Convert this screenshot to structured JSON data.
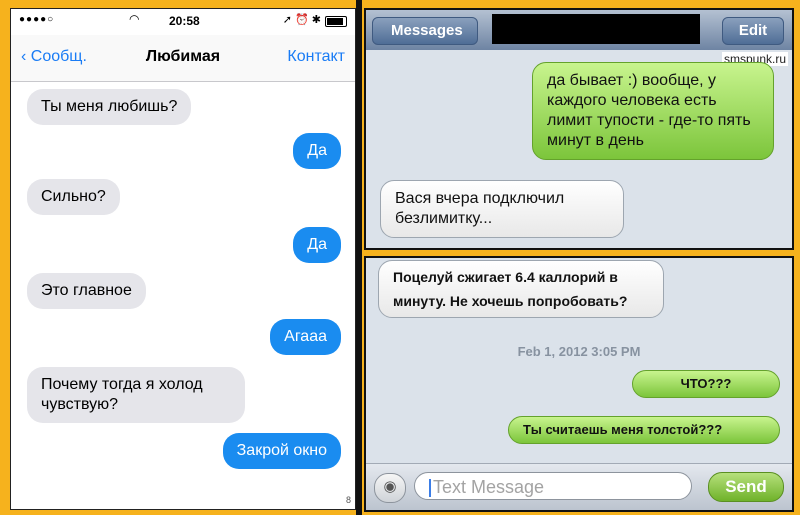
{
  "left": {
    "status": {
      "signal": "●●●●○",
      "time": "20:58",
      "icons": "➚ ⏰ ✱"
    },
    "nav": {
      "back": "Сообщ.",
      "title": "Любимая",
      "contact": "Контакт"
    },
    "messages": [
      {
        "dir": "in",
        "text": "Ты меня любишь?"
      },
      {
        "dir": "out",
        "text": "Да"
      },
      {
        "dir": "in",
        "text": "Сильно?"
      },
      {
        "dir": "out",
        "text": "Да"
      },
      {
        "dir": "in",
        "text": "Это главное"
      },
      {
        "dir": "out",
        "text": "Агааа"
      },
      {
        "dir": "in",
        "text": "Почему тогда я холод чувствую?"
      },
      {
        "dir": "out",
        "text": "Закрой окно"
      }
    ],
    "scroll_char": "8"
  },
  "right_top": {
    "nav": {
      "back": "Messages",
      "edit": "Edit"
    },
    "watermark": "smspunk.ru",
    "messages": [
      {
        "dir": "out",
        "text": "да бывает :) вообще, у каждого человека есть лимит тупости - где-то пять минут в день"
      },
      {
        "dir": "in",
        "text": "Вася вчера подключил безлимитку..."
      }
    ]
  },
  "right_bottom": {
    "messages": [
      {
        "dir": "in",
        "text": "Поцелуй сжигает 6.4 каллорий в минуту. Не хочешь попробовать?"
      },
      {
        "dir": "out",
        "text": "ЧТО???"
      },
      {
        "dir": "out",
        "text": "Ты считаешь меня толстой???"
      }
    ],
    "timestamp": "Feb 1, 2012 3:05 PM",
    "input_placeholder": "Text Message",
    "send": "Send"
  },
  "colors": {
    "frame": "#f6b21d",
    "ios7_blue": "#1a8cf0",
    "ios7_gray": "#e5e5ea",
    "green_bubble": "#7cc53b"
  }
}
